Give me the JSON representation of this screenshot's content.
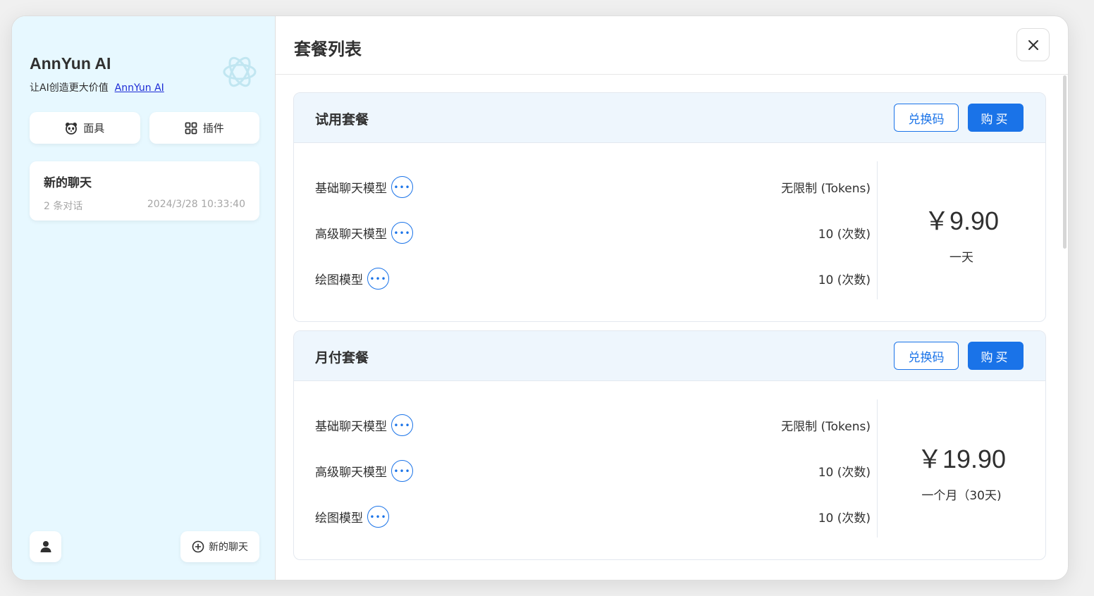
{
  "brand": {
    "title": "AnnYun AI",
    "subtitle": "让AI创造更大价值",
    "link": "AnnYun AI"
  },
  "sidebar": {
    "mask_label": "面具",
    "plugin_label": "插件",
    "chats": [
      {
        "title": "新的聊天",
        "count": "2 条对话",
        "time": "2024/3/28 10:33:40"
      }
    ],
    "new_chat_label": "新的聊天"
  },
  "header": {
    "title": "套餐列表"
  },
  "plans": [
    {
      "name": "试用套餐",
      "redeem_label": "兑换码",
      "buy_label": "购买",
      "features": [
        {
          "label": "基础聊天模型",
          "value": "无限制 (Tokens)"
        },
        {
          "label": "高级聊天模型",
          "value": "10 (次数)"
        },
        {
          "label": "绘图模型",
          "value": "10 (次数)"
        }
      ],
      "price": "￥9.90",
      "period": "一天"
    },
    {
      "name": "月付套餐",
      "redeem_label": "兑换码",
      "buy_label": "购买",
      "features": [
        {
          "label": "基础聊天模型",
          "value": "无限制 (Tokens)"
        },
        {
          "label": "高级聊天模型",
          "value": "10 (次数)"
        },
        {
          "label": "绘图模型",
          "value": "10 (次数)"
        }
      ],
      "price": "￥19.90",
      "period": "一个月（30天)"
    }
  ],
  "colors": {
    "accent": "#1a73e8",
    "sidebar_bg": "#e7f8ff",
    "plan_head_bg": "#eef6fd"
  }
}
